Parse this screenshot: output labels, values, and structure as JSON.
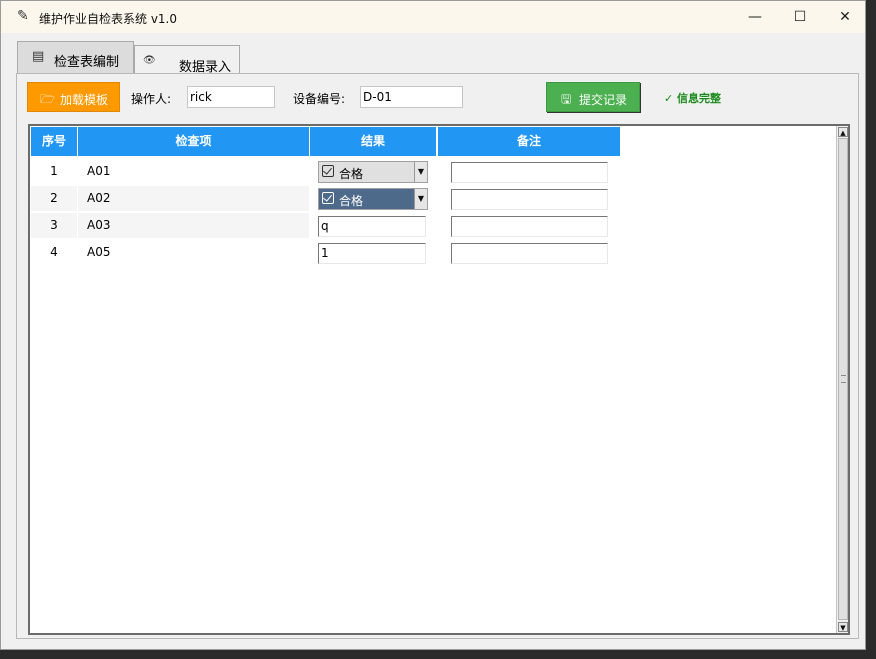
{
  "window": {
    "title": "维护作业自检表系统 v1.0",
    "controls": {
      "minimize": "—",
      "maximize": "☐",
      "close": "✕"
    }
  },
  "tabs": [
    {
      "label": "检查表编制",
      "icon": "clipboard-icon",
      "active": false
    },
    {
      "label": "数据录入",
      "icon": "eye-icon",
      "active": true
    }
  ],
  "toolbar": {
    "load_button": "加载模板",
    "operator_label": "操作人:",
    "operator_value": "rick",
    "device_label": "设备编号:",
    "device_value": "D-01",
    "submit_button": "提交记录",
    "status_text": "✓ 信息完整"
  },
  "table": {
    "headers": {
      "seq": "序号",
      "item": "检查项",
      "result": "结果",
      "note": "备注"
    },
    "rows": [
      {
        "seq": "1",
        "item": "A01",
        "result": "合格",
        "result_type": "combo",
        "note": ""
      },
      {
        "seq": "2",
        "item": "A02",
        "result": "合格",
        "result_type": "combo",
        "selected": true,
        "note": ""
      },
      {
        "seq": "3",
        "item": "A03",
        "result": "q",
        "result_type": "entry",
        "note": ""
      },
      {
        "seq": "4",
        "item": "A05",
        "result": "1",
        "result_type": "entry",
        "note": ""
      }
    ]
  },
  "colors": {
    "header_bg": "#2196f3",
    "load_button": "#ff9900",
    "submit_button": "#4caf50",
    "status_text": "#1a8a1a",
    "combo_selected": "#4d6a8a"
  }
}
